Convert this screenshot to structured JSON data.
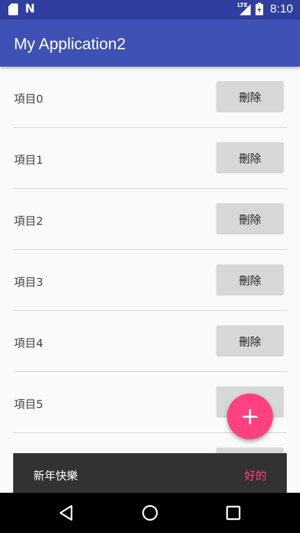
{
  "status_bar": {
    "network_label": "LTE",
    "time": "8:10",
    "icons": [
      "sd-card-icon",
      "n-icon",
      "signal-icon",
      "battery-icon"
    ]
  },
  "app_bar": {
    "title": "My Application2"
  },
  "list": {
    "items": [
      {
        "label": "項目0",
        "button": "刪除"
      },
      {
        "label": "項目1",
        "button": "刪除"
      },
      {
        "label": "項目2",
        "button": "刪除"
      },
      {
        "label": "項目3",
        "button": "刪除"
      },
      {
        "label": "項目4",
        "button": "刪除"
      },
      {
        "label": "項目5",
        "button": "刪除"
      },
      {
        "label": "",
        "button": ""
      }
    ]
  },
  "fab": {
    "icon": "add-icon",
    "glyph": "+"
  },
  "snackbar": {
    "message": "新年快樂",
    "action": "好的"
  },
  "nav_bar": {
    "icons": [
      "back-icon",
      "home-icon",
      "recents-icon"
    ]
  },
  "colors": {
    "primary": "#3f51b5",
    "primary_dark": "#303f9f",
    "accent": "#ff4081"
  }
}
